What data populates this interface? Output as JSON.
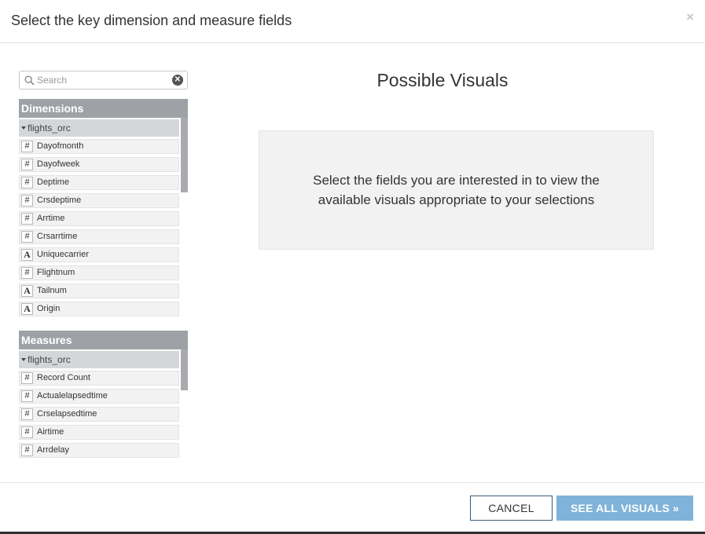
{
  "modal": {
    "title": "Select the key dimension and measure fields",
    "close_glyph": "×"
  },
  "search": {
    "placeholder": "Search",
    "value": "",
    "clear_glyph": "✕"
  },
  "dimensions": {
    "header": "Dimensions",
    "group": "flights_orc",
    "fields": [
      {
        "type": "#",
        "label": "Dayofmonth"
      },
      {
        "type": "#",
        "label": "Dayofweek"
      },
      {
        "type": "#",
        "label": "Deptime"
      },
      {
        "type": "#",
        "label": "Crsdeptime"
      },
      {
        "type": "#",
        "label": "Arrtime"
      },
      {
        "type": "#",
        "label": "Crsarrtime"
      },
      {
        "type": "A",
        "label": "Uniquecarrier"
      },
      {
        "type": "#",
        "label": "Flightnum"
      },
      {
        "type": "A",
        "label": "Tailnum"
      },
      {
        "type": "A",
        "label": "Origin"
      }
    ]
  },
  "measures": {
    "header": "Measures",
    "group": "flights_orc",
    "fields": [
      {
        "type": "#",
        "label": "Record Count"
      },
      {
        "type": "#",
        "label": "Actualelapsedtime"
      },
      {
        "type": "#",
        "label": "Crselapsedtime"
      },
      {
        "type": "#",
        "label": "Airtime"
      },
      {
        "type": "#",
        "label": "Arrdelay"
      }
    ]
  },
  "visuals": {
    "title": "Possible Visuals",
    "message": "Select the fields you are interested in to view the available visuals appropriate to your selections"
  },
  "footer": {
    "cancel_label": "CANCEL",
    "see_all_label": "SEE ALL VISUALS »"
  },
  "icons": {
    "search": "search-icon",
    "clear": "clear-search-icon",
    "close": "close-icon",
    "caret": "caret-down-icon",
    "numeric": "numeric-type-icon",
    "text": "text-type-icon"
  },
  "colors": {
    "panel_header": "#9ea2a7",
    "group_header": "#d4d6d8",
    "primary_button": "#7fb3d9",
    "cancel_border": "#3b5b78",
    "info_box": "#f2f2f2"
  }
}
